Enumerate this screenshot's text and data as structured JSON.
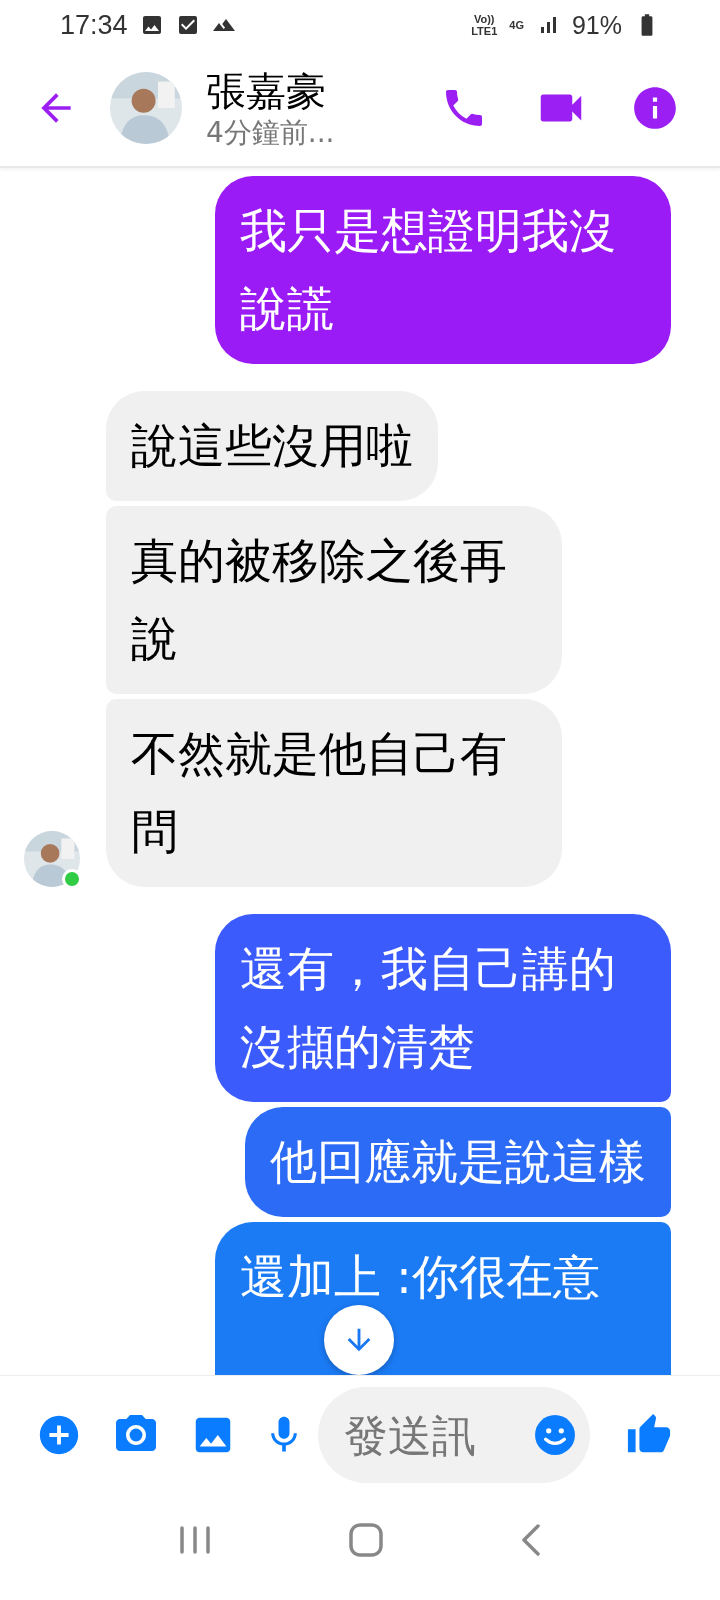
{
  "status_bar": {
    "time": "17:34",
    "network_labels": [
      "Vo))",
      "LTE1",
      "4G"
    ],
    "battery": "91%"
  },
  "header": {
    "name": "張嘉豪",
    "status": "4分鐘前..."
  },
  "messages": [
    {
      "kind": "sent",
      "text": "我只是想證明我沒說謊",
      "color": "#9a1bf6"
    },
    {
      "kind": "received",
      "text": "說這些沒用啦"
    },
    {
      "kind": "received",
      "text": "真的被移除之後再說"
    },
    {
      "kind": "received",
      "text": "不然就是他自己有問",
      "avatar": {
        "online": true
      }
    },
    {
      "kind": "sent",
      "text": "還有，我自己講的沒擷的清楚",
      "color": "#3b5bfd"
    },
    {
      "kind": "sent",
      "text": "他回應就是說這樣",
      "color": "#2c6bf6"
    },
    {
      "kind": "sent",
      "text": "還加上 :你很在意",
      "color": "#1b7bf5"
    }
  ],
  "composer": {
    "placeholder": "發送訊"
  }
}
